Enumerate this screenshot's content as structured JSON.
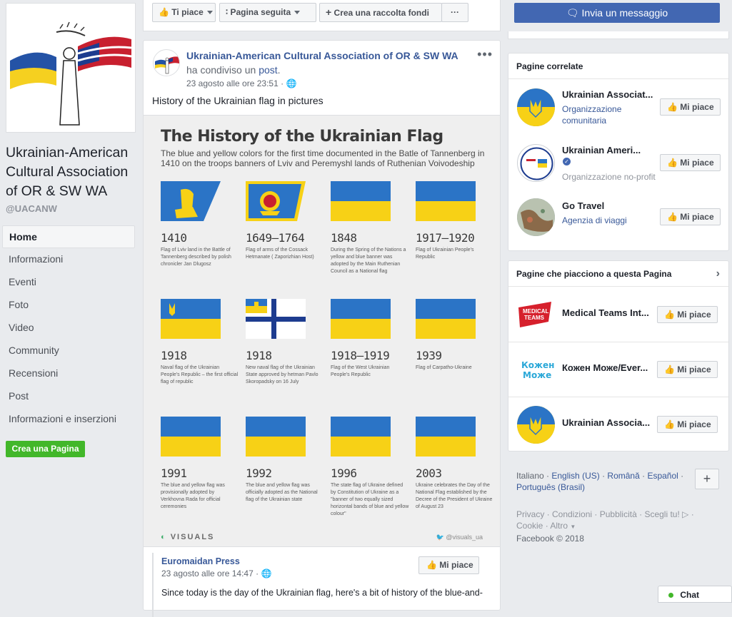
{
  "page": {
    "name": "Ukrainian-American Cultural Association of OR & SW WA",
    "handle": "@UACANW"
  },
  "nav": {
    "items": [
      "Home",
      "Informazioni",
      "Eventi",
      "Foto",
      "Video",
      "Community",
      "Recensioni",
      "Post",
      "Informazioni e inserzioni"
    ],
    "create_page": "Crea una Pagina"
  },
  "toolbar": {
    "like": "Ti piace",
    "follow": "Pagina seguita",
    "fundraiser": "Crea una raccolta fondi",
    "more": "···"
  },
  "post": {
    "author": "Ukrainian-American Cultural Association of OR & SW WA",
    "shared_prefix": "ha condiviso un",
    "shared_link": "post",
    "time": "23 agosto alle ore 23:51",
    "text": "History of the Ukrainian flag in pictures"
  },
  "infographic": {
    "title": "The History of the Ukrainian Flag",
    "subtitle": "The blue and yellow colors for the first time documented in the Batle of Tannenberg in 1410 on the troops banners of Lviv and Peremyshl lands of Ruthenian Voivodeship",
    "items": [
      {
        "year": "1410",
        "desc": "Flag of Lviv land in the Battle of Tannenberg described by polish chronicler Jan Dlugosz"
      },
      {
        "year": "1649–1764",
        "desc": "Flag of arms of the Cossack Hetmanate ( Zaporizhian Host)"
      },
      {
        "year": "1848",
        "desc": "During the Spring of the Nations a yellow and blue banner was adopted by the Main Ruthenian Council as a National flag"
      },
      {
        "year": "1917–1920",
        "desc": "Flag of Ukrainian People's Republic"
      },
      {
        "year": "1918",
        "desc": "Naval flag of the Ukrainian People's Republic – the first official flag of republic"
      },
      {
        "year": "1918",
        "desc": "New naval flag of the Ukrainian State approved by hetman Pavlo Skoropadsky on 16 July"
      },
      {
        "year": "1918–1919",
        "desc": "Flag of the West Ukrainian People's Republic"
      },
      {
        "year": "1939",
        "desc": "Flag of Carpatho-Ukraine"
      },
      {
        "year": "1991",
        "desc": "The blue and yellow flag was provisionally adopted by Verkhovna Rada for official ceremonies"
      },
      {
        "year": "1992",
        "desc": "The blue and yellow flag was officially adopted as the National flag of the Ukrainian state"
      },
      {
        "year": "1996",
        "desc": "The state flag of Ukraine defined by Constitution of Ukraine as a \"banner of two equally sized horizontal bands of blue and yellow colour\""
      },
      {
        "year": "2003",
        "desc": "Ukraine celebrates the Day of the National Flag established by the Decree of the President of Ukraine of August 23"
      }
    ],
    "brand": "VISUALS",
    "brand_handle": "@visuals_ua"
  },
  "shared_post": {
    "name": "Euromaidan Press",
    "time": "23 agosto alle ore 14:47",
    "like": "Mi piace",
    "text": "Since today is the day of the Ukrainian flag, here's a bit of history of the blue-and-"
  },
  "sidebar": {
    "message_button": "Invia un messaggio",
    "related_title": "Pagine correlate",
    "related": [
      {
        "name": "Ukrainian Associat...",
        "category": "Organizzazione comunitaria",
        "like": "Mi piace"
      },
      {
        "name": "Ukrainian Ameri...",
        "category": "Organizzazione no-profit",
        "like": "Mi piace"
      },
      {
        "name": "Go Travel",
        "category": "Agenzia di viaggi",
        "like": "Mi piace"
      }
    ],
    "liked_title": "Pagine che piacciono a questa Pagina",
    "liked": [
      {
        "name": "Medical Teams Int...",
        "like": "Mi piace"
      },
      {
        "name": "Кожен Може/Ever...",
        "like": "Mi piace"
      },
      {
        "name": "Ukrainian Associa...",
        "like": "Mi piace"
      }
    ],
    "lang_current": "Italiano",
    "languages": [
      "English (US)",
      "Română",
      "Español",
      "Português (Brasil)"
    ],
    "footer_links": [
      "Privacy",
      "Condizioni",
      "Pubblicità",
      "Scegli tu!",
      "Cookie",
      "Altro"
    ],
    "copyright": "Facebook © 2018"
  },
  "chat": {
    "label": "Chat"
  },
  "colors": {
    "fb_blue": "#4267b2",
    "link": "#385898",
    "green": "#42b72a",
    "ua_blue": "#2b74c6",
    "ua_yellow": "#f7d116"
  }
}
